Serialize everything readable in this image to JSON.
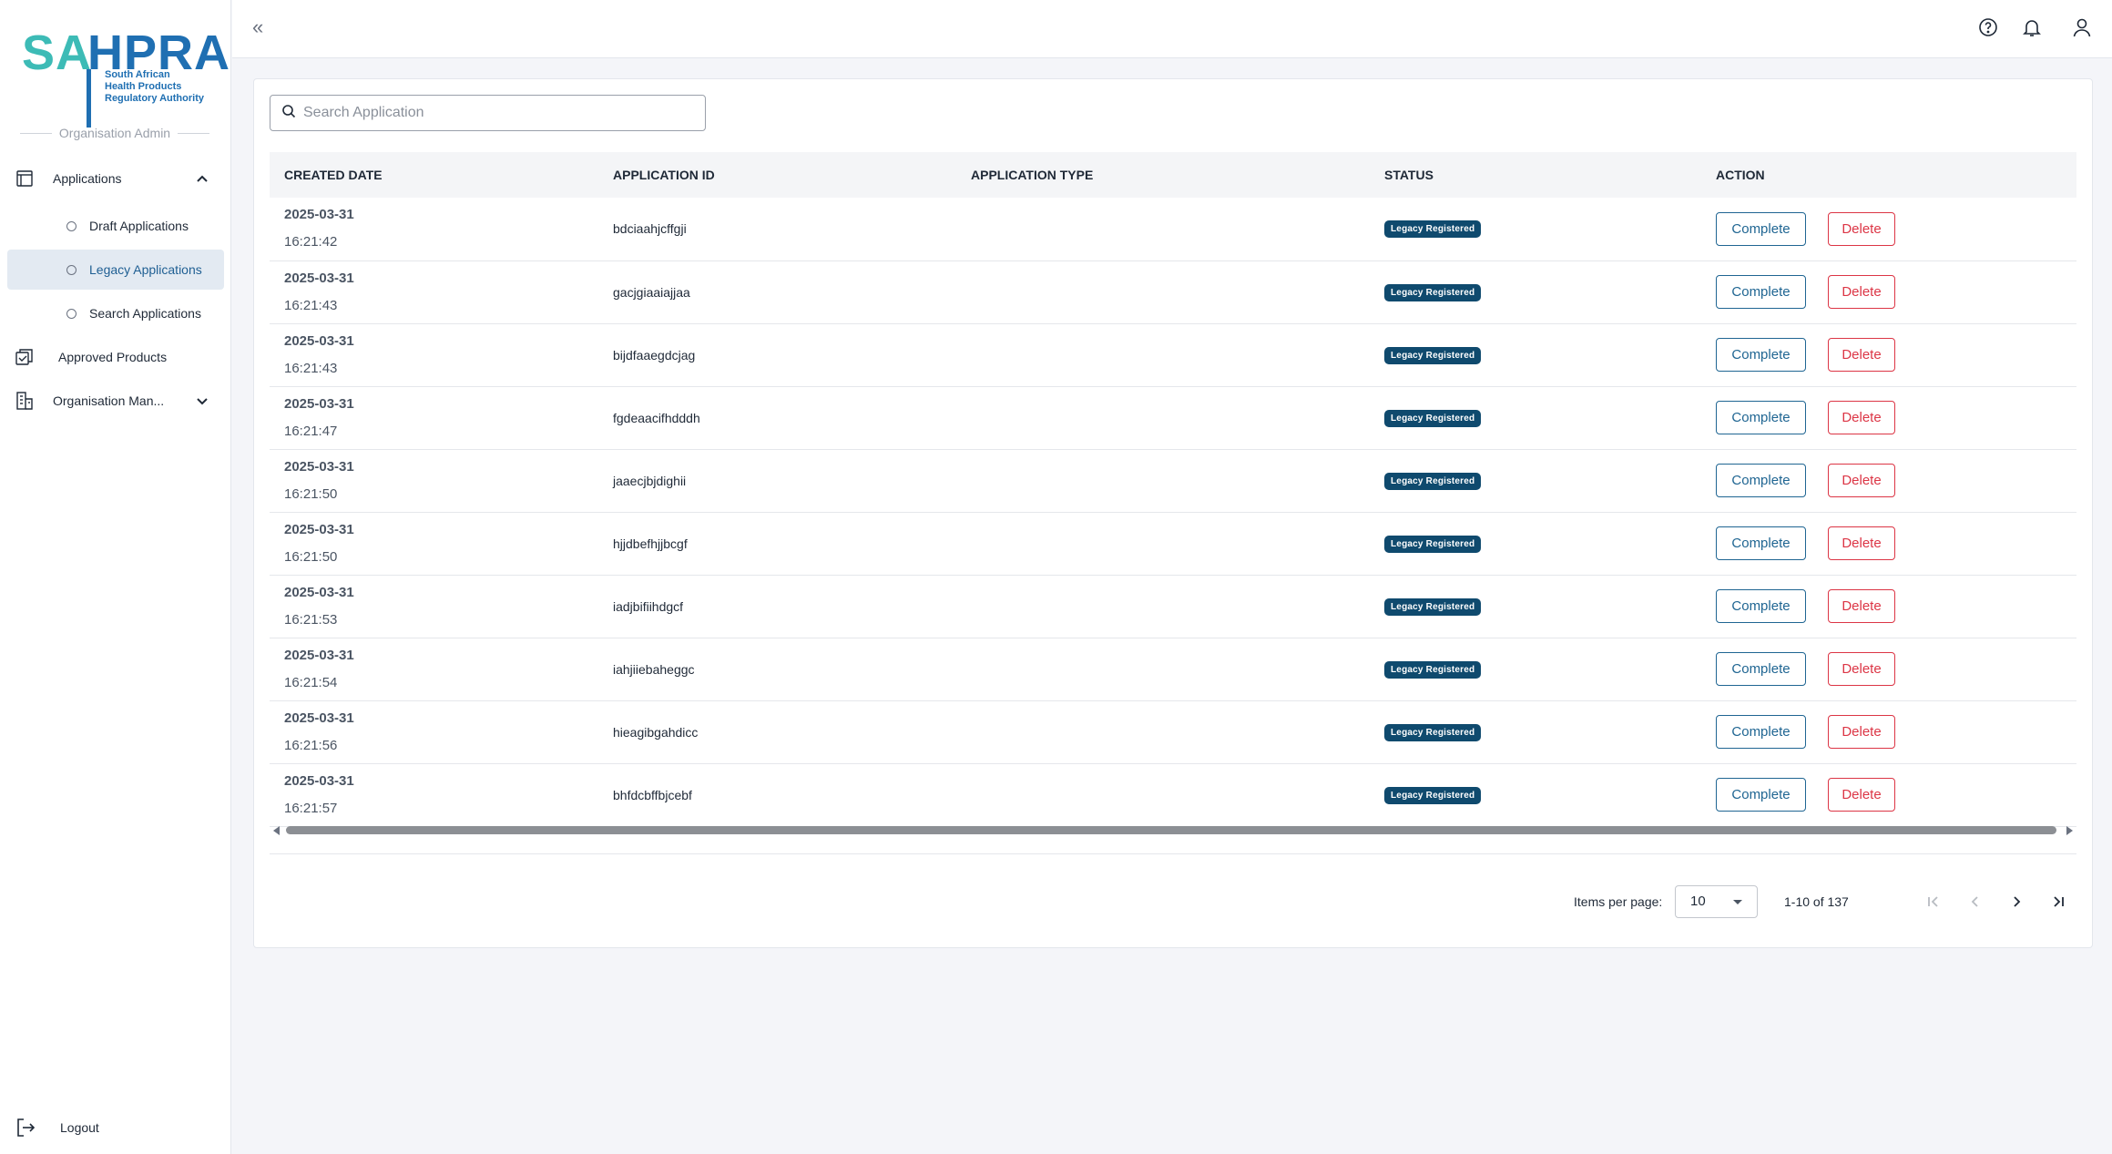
{
  "brand": {
    "logo_part1": "SA",
    "logo_part2": "HPRA",
    "subtitle_lines": [
      "South African",
      "Health Products",
      "Regulatory Authority"
    ],
    "teal_color": "#3dbbb6",
    "blue_color": "#1f6fb2"
  },
  "sidebar": {
    "role_label": "Organisation Admin",
    "applications_label": "Applications",
    "sub_items": [
      {
        "label": "Draft Applications",
        "active": false
      },
      {
        "label": "Legacy Applications",
        "active": true
      },
      {
        "label": "Search Applications",
        "active": false
      }
    ],
    "approved_products_label": "Approved Products",
    "organisation_label": "Organisation Man...",
    "logout_label": "Logout"
  },
  "topbar": {
    "collapse_glyph": "«",
    "icons": [
      "help-icon",
      "bell-icon",
      "user-icon"
    ]
  },
  "search": {
    "placeholder": "Search Application",
    "value": ""
  },
  "table": {
    "headers": {
      "created_date": "CREATED DATE",
      "application_id": "APPLICATION ID",
      "application_type": "APPLICATION TYPE",
      "status": "STATUS",
      "action": "ACTION"
    },
    "complete_label": "Complete",
    "delete_label": "Delete",
    "rows": [
      {
        "date": "2025-03-31",
        "time": "16:21:42",
        "id": "bdciaahjcffgji",
        "type": "",
        "status": "Legacy Registered"
      },
      {
        "date": "2025-03-31",
        "time": "16:21:43",
        "id": "gacjgiaaiajjaa",
        "type": "",
        "status": "Legacy Registered"
      },
      {
        "date": "2025-03-31",
        "time": "16:21:43",
        "id": "bijdfaaegdcjag",
        "type": "",
        "status": "Legacy Registered"
      },
      {
        "date": "2025-03-31",
        "time": "16:21:47",
        "id": "fgdeaacifhdddh",
        "type": "",
        "status": "Legacy Registered"
      },
      {
        "date": "2025-03-31",
        "time": "16:21:50",
        "id": "jaaecjbjdighii",
        "type": "",
        "status": "Legacy Registered"
      },
      {
        "date": "2025-03-31",
        "time": "16:21:50",
        "id": "hjjdbefhjjbcgf",
        "type": "",
        "status": "Legacy Registered"
      },
      {
        "date": "2025-03-31",
        "time": "16:21:53",
        "id": "iadjbifiihdgcf",
        "type": "",
        "status": "Legacy Registered"
      },
      {
        "date": "2025-03-31",
        "time": "16:21:54",
        "id": "iahjiiebaheggc",
        "type": "",
        "status": "Legacy Registered"
      },
      {
        "date": "2025-03-31",
        "time": "16:21:56",
        "id": "hieagibgahdicc",
        "type": "",
        "status": "Legacy Registered"
      },
      {
        "date": "2025-03-31",
        "time": "16:21:57",
        "id": "bhfdcbffbjcebf",
        "type": "",
        "status": "Legacy Registered"
      }
    ]
  },
  "pagination": {
    "items_per_page_label": "Items per page:",
    "items_per_page_value": "10",
    "range_label": "1-10 of 137"
  }
}
